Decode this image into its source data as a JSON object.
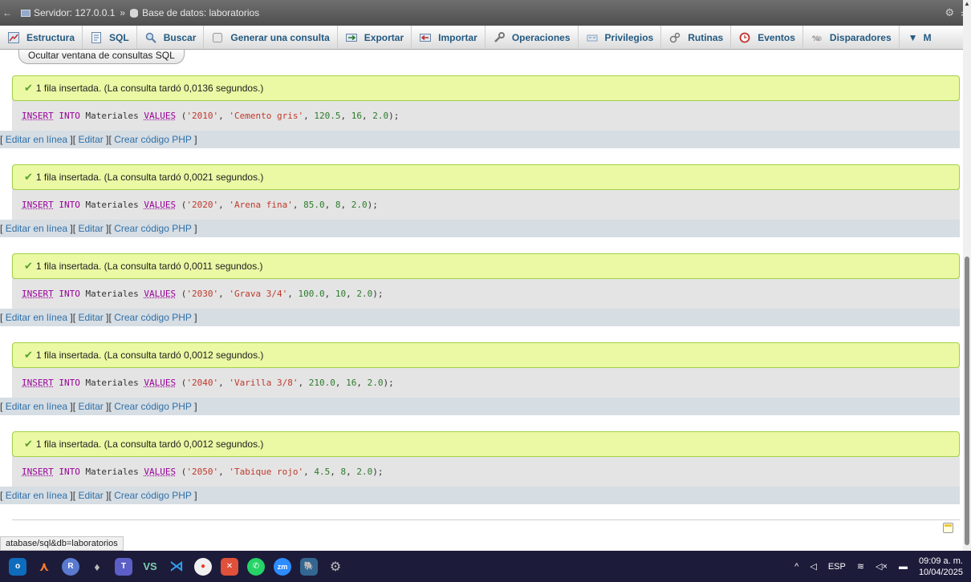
{
  "breadcrumb": {
    "server": "Servidor: 127.0.0.1",
    "separator": "»",
    "database": "Base de datos: laboratorios"
  },
  "tabs": [
    {
      "label": "Estructura",
      "icon": "structure-icon"
    },
    {
      "label": "SQL",
      "icon": "sql-icon"
    },
    {
      "label": "Buscar",
      "icon": "search-icon"
    },
    {
      "label": "Generar una consulta",
      "icon": "query-icon"
    },
    {
      "label": "Exportar",
      "icon": "export-icon"
    },
    {
      "label": "Importar",
      "icon": "import-icon"
    },
    {
      "label": "Operaciones",
      "icon": "wrench-icon"
    },
    {
      "label": "Privilegios",
      "icon": "privileges-icon"
    },
    {
      "label": "Rutinas",
      "icon": "routines-icon"
    },
    {
      "label": "Eventos",
      "icon": "clock-icon"
    },
    {
      "label": "Disparadores",
      "icon": "triggers-icon"
    },
    {
      "label": "M",
      "icon": "chevron-down-icon"
    }
  ],
  "hide_sql_label": "Ocultar ventana de consultas SQL",
  "links": {
    "open": "[",
    "close": "]",
    "inline": "Editar en línea",
    "edit": "Editar",
    "php": "Crear código PHP"
  },
  "results": [
    {
      "msg": "1 fila insertada. (La consulta tardó 0,0136 segundos.)",
      "code": "2010",
      "name": "Cemento gris",
      "price": "120.5",
      "qty": "16",
      "factor": "2.0"
    },
    {
      "msg": "1 fila insertada. (La consulta tardó 0,0021 segundos.)",
      "code": "2020",
      "name": "Arena fina",
      "price": "85.0",
      "qty": "8",
      "factor": "2.0"
    },
    {
      "msg": "1 fila insertada. (La consulta tardó 0,0011 segundos.)",
      "code": "2030",
      "name": "Grava 3/4",
      "price": "100.0",
      "qty": "10",
      "factor": "2.0"
    },
    {
      "msg": "1 fila insertada. (La consulta tardó 0,0012 segundos.)",
      "code": "2040",
      "name": "Varilla 3/8",
      "price": "210.0",
      "qty": "16",
      "factor": "2.0"
    },
    {
      "msg": "1 fila insertada. (La consulta tardó 0,0012 segundos.)",
      "code": "2050",
      "name": "Tabique rojo",
      "price": "4.5",
      "qty": "8",
      "factor": "2.0"
    }
  ],
  "sql": {
    "insert": "INSERT",
    "into": "INTO",
    "table": "Materiales",
    "values": "VALUES"
  },
  "status_url": "atabase/sql&db=laboratorios",
  "tray": {
    "lang": "ESP",
    "time": "09:09 a. m.",
    "date": "10/04/2025"
  },
  "colors": {
    "success_bg": "#ebf8a4",
    "success_border": "#a2d246",
    "link": "#2f70a8",
    "keyword": "#990099",
    "taskbar": "#1d1b3a"
  }
}
